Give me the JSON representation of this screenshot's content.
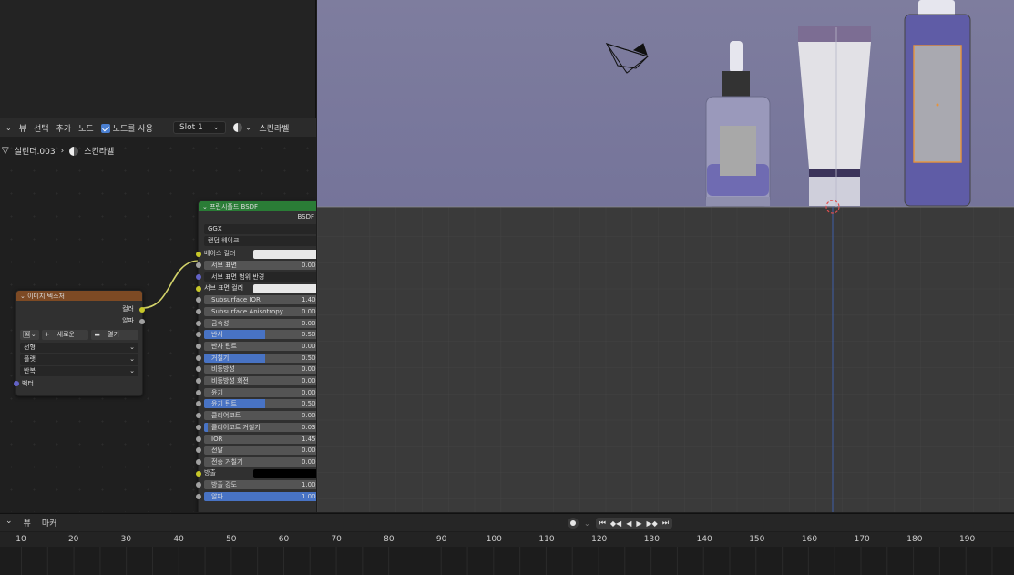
{
  "node_header": {
    "menu": [
      "뷰",
      "선택",
      "추가",
      "노드"
    ],
    "use_nodes_label": "노드를 사용",
    "slot": "Slot 1",
    "material_name": "스킨라벨"
  },
  "breadcrumb": {
    "object": "실린더.003",
    "material": "스킨라벨"
  },
  "image_texture_node": {
    "title": "이미지 텍스처",
    "outputs": [
      "컬러",
      "알파"
    ],
    "new_label": "새로운",
    "open_label": "열기",
    "dropdowns": [
      "선형",
      "플랫",
      "반복"
    ],
    "input": "벡터"
  },
  "bsdf_node": {
    "title": "프린시플드 BSDF",
    "output": "BSDF",
    "distribution": "GGX",
    "subsurface_method": "랜덤 웨이크",
    "base_color": "베이스 컬러",
    "rows": [
      {
        "label": "서브 표면",
        "value": "0.000",
        "fill": 0.0,
        "socket": "g"
      },
      {
        "label": "서브 표면 범위 반경",
        "value": "",
        "fill": 0.0,
        "socket": "p",
        "dark": true
      },
      {
        "label": "서브 표면 컬러",
        "value": "",
        "fill": 0.0,
        "socket": "y",
        "swatch": "#e8e8e8"
      },
      {
        "label": "Subsurface IOR",
        "value": "1.400",
        "fill": 0.0,
        "socket": "g"
      },
      {
        "label": "Subsurface Anisotropy",
        "value": "0.000",
        "fill": 0.0,
        "socket": "g"
      },
      {
        "label": "금속성",
        "value": "0.000",
        "fill": 0.0,
        "socket": "g"
      },
      {
        "label": "반사",
        "value": "0.500",
        "fill": 0.5,
        "socket": "g"
      },
      {
        "label": "반사 틴트",
        "value": "0.000",
        "fill": 0.0,
        "socket": "g"
      },
      {
        "label": "거칠기",
        "value": "0.500",
        "fill": 0.5,
        "socket": "g"
      },
      {
        "label": "비등방성",
        "value": "0.000",
        "fill": 0.0,
        "socket": "g"
      },
      {
        "label": "비등방성 회전",
        "value": "0.000",
        "fill": 0.0,
        "socket": "g"
      },
      {
        "label": "윤기",
        "value": "0.000",
        "fill": 0.0,
        "socket": "g"
      },
      {
        "label": "윤기 틴트",
        "value": "0.500",
        "fill": 0.5,
        "socket": "g"
      },
      {
        "label": "클리어코트",
        "value": "0.000",
        "fill": 0.0,
        "socket": "g"
      },
      {
        "label": "클리어코트 거칠기",
        "value": "0.030",
        "fill": 0.03,
        "socket": "g"
      },
      {
        "label": "IOR",
        "value": "1.450",
        "fill": 0.0,
        "socket": "g"
      },
      {
        "label": "전달",
        "value": "0.000",
        "fill": 0.0,
        "socket": "g"
      },
      {
        "label": "전송 거칠기",
        "value": "0.000",
        "fill": 0.0,
        "socket": "g"
      },
      {
        "label": "방출",
        "value": "",
        "fill": 0.0,
        "socket": "y",
        "swatch": "#000000",
        "plain": true
      },
      {
        "label": "방출 강도",
        "value": "1.000",
        "fill": 0.0,
        "socket": "g"
      },
      {
        "label": "알파",
        "value": "1.000",
        "fill": 1.0,
        "socket": "g"
      }
    ]
  },
  "timeline": {
    "menu": [
      "뷰",
      "마커"
    ],
    "frames": [
      "10",
      "20",
      "30",
      "40",
      "50",
      "60",
      "70",
      "80",
      "90",
      "100",
      "110",
      "120",
      "130",
      "140",
      "150",
      "160",
      "170",
      "180",
      "190"
    ]
  },
  "colors": {
    "bsdf_header": "#2a7c36",
    "texture_header": "#7d4a24",
    "slider_fill": "#4873c4",
    "viewport_wall": "#7b7a9b",
    "viewport_floor": "#3a3a3a"
  }
}
